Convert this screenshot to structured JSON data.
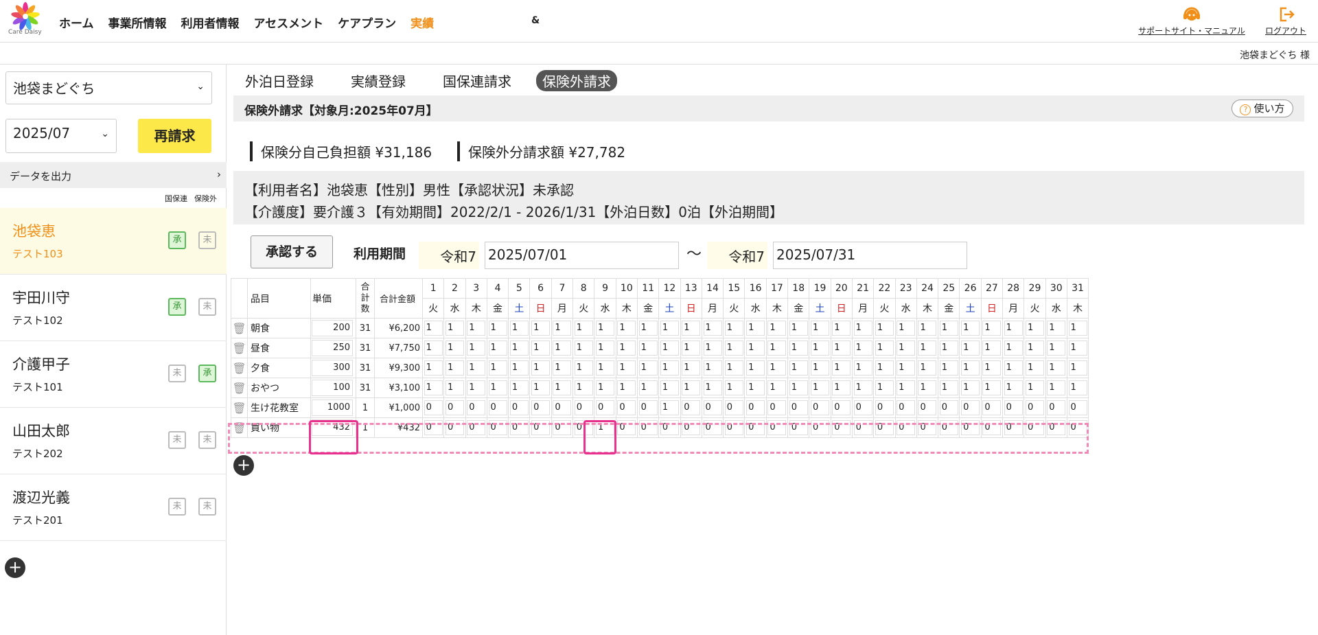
{
  "brand": {
    "logo_text": "Care Daisy"
  },
  "nav": {
    "items": [
      "ホーム",
      "事業所情報",
      "利用者情報",
      "アセスメント",
      "ケアプラン",
      "実績"
    ],
    "active_index": 5,
    "extra_glyph": "&"
  },
  "header_links": {
    "support": "サポートサイト・マニュアル",
    "logout": "ログアウト"
  },
  "user_bar": {
    "name": "池袋まどぐち 様"
  },
  "sidebar": {
    "office_select": "池袋まどぐち",
    "month_select": "2025/07",
    "rebill_button": "再請求",
    "export_label": "データを出力",
    "col_kokuho": "国保連",
    "col_hokengai": "保険外",
    "clients": [
      {
        "name": "池袋恵",
        "sub": "テスト103",
        "kokuho": "承",
        "hokengai": "未",
        "selected": true
      },
      {
        "name": "宇田川守",
        "sub": "テスト102",
        "kokuho": "承",
        "hokengai": "未",
        "selected": false
      },
      {
        "name": "介護甲子",
        "sub": "テスト101",
        "kokuho": "未",
        "hokengai": "承",
        "selected": false
      },
      {
        "name": "山田太郎",
        "sub": "テスト202",
        "kokuho": "未",
        "hokengai": "未",
        "selected": false
      },
      {
        "name": "渡辺光義",
        "sub": "テスト201",
        "kokuho": "未",
        "hokengai": "未",
        "selected": false
      }
    ]
  },
  "tabs": [
    "外泊日登録",
    "実績登録",
    "国保連請求",
    "保険外請求"
  ],
  "active_tab": 3,
  "section": {
    "title": "保険外請求【対象月:2025年07月】",
    "help": "使い方"
  },
  "amounts": {
    "insured": "保険分自己負担額 ¥31,186",
    "uninsured": "保険外分請求額 ¥27,782"
  },
  "info": {
    "line1": "【利用者名】池袋恵【性別】男性【承認状況】未承認",
    "line2": "【介護度】要介護３【有効期間】2022/2/1 - 2026/1/31【外泊日数】0泊【外泊期間】"
  },
  "period": {
    "approve_button": "承認する",
    "label": "利用期間",
    "era_from": "令和7",
    "from": "2025/07/01",
    "tilde": "～",
    "era_to": "令和7",
    "to": "2025/07/31"
  },
  "table": {
    "headers": {
      "item": "品目",
      "price": "単価",
      "count": "合計数",
      "sum": "合計金額"
    },
    "days": [
      "1",
      "2",
      "3",
      "4",
      "5",
      "6",
      "7",
      "8",
      "9",
      "10",
      "11",
      "12",
      "13",
      "14",
      "15",
      "16",
      "17",
      "18",
      "19",
      "20",
      "21",
      "22",
      "23",
      "24",
      "25",
      "26",
      "27",
      "28",
      "29",
      "30",
      "31"
    ],
    "weekdays": [
      "火",
      "水",
      "木",
      "金",
      "土",
      "日",
      "月",
      "火",
      "水",
      "木",
      "金",
      "土",
      "日",
      "月",
      "火",
      "水",
      "木",
      "金",
      "土",
      "日",
      "月",
      "火",
      "水",
      "木",
      "金",
      "土",
      "日",
      "月",
      "火",
      "水",
      "木"
    ],
    "rows": [
      {
        "item": "朝食",
        "price": "200",
        "count": "31",
        "sum": "¥6,200",
        "days": [
          "1",
          "1",
          "1",
          "1",
          "1",
          "1",
          "1",
          "1",
          "1",
          "1",
          "1",
          "1",
          "1",
          "1",
          "1",
          "1",
          "1",
          "1",
          "1",
          "1",
          "1",
          "1",
          "1",
          "1",
          "1",
          "1",
          "1",
          "1",
          "1",
          "1",
          "1"
        ]
      },
      {
        "item": "昼食",
        "price": "250",
        "count": "31",
        "sum": "¥7,750",
        "days": [
          "1",
          "1",
          "1",
          "1",
          "1",
          "1",
          "1",
          "1",
          "1",
          "1",
          "1",
          "1",
          "1",
          "1",
          "1",
          "1",
          "1",
          "1",
          "1",
          "1",
          "1",
          "1",
          "1",
          "1",
          "1",
          "1",
          "1",
          "1",
          "1",
          "1",
          "1"
        ]
      },
      {
        "item": "夕食",
        "price": "300",
        "count": "31",
        "sum": "¥9,300",
        "days": [
          "1",
          "1",
          "1",
          "1",
          "1",
          "1",
          "1",
          "1",
          "1",
          "1",
          "1",
          "1",
          "1",
          "1",
          "1",
          "1",
          "1",
          "1",
          "1",
          "1",
          "1",
          "1",
          "1",
          "1",
          "1",
          "1",
          "1",
          "1",
          "1",
          "1",
          "1"
        ]
      },
      {
        "item": "おやつ",
        "price": "100",
        "count": "31",
        "sum": "¥3,100",
        "days": [
          "1",
          "1",
          "1",
          "1",
          "1",
          "1",
          "1",
          "1",
          "1",
          "1",
          "1",
          "1",
          "1",
          "1",
          "1",
          "1",
          "1",
          "1",
          "1",
          "1",
          "1",
          "1",
          "1",
          "1",
          "1",
          "1",
          "1",
          "1",
          "1",
          "1",
          "1"
        ]
      },
      {
        "item": "生け花教室",
        "price": "1000",
        "count": "1",
        "sum": "¥1,000",
        "days": [
          "0",
          "0",
          "0",
          "0",
          "0",
          "0",
          "0",
          "0",
          "0",
          "0",
          "0",
          "1",
          "0",
          "0",
          "0",
          "0",
          "0",
          "0",
          "0",
          "0",
          "0",
          "0",
          "0",
          "0",
          "0",
          "0",
          "0",
          "0",
          "0",
          "0",
          "0"
        ]
      },
      {
        "item": "買い物",
        "price": "432",
        "count": "1",
        "sum": "¥432",
        "days": [
          "0",
          "0",
          "0",
          "0",
          "0",
          "0",
          "0",
          "0",
          "1",
          "0",
          "0",
          "0",
          "0",
          "0",
          "0",
          "0",
          "0",
          "0",
          "0",
          "0",
          "0",
          "0",
          "0",
          "0",
          "0",
          "0",
          "0",
          "0",
          "0",
          "0",
          "0"
        ]
      }
    ]
  },
  "colors": {
    "accent": "#f0901a",
    "rebill": "#fde84a",
    "highlight": "#e8308f"
  }
}
